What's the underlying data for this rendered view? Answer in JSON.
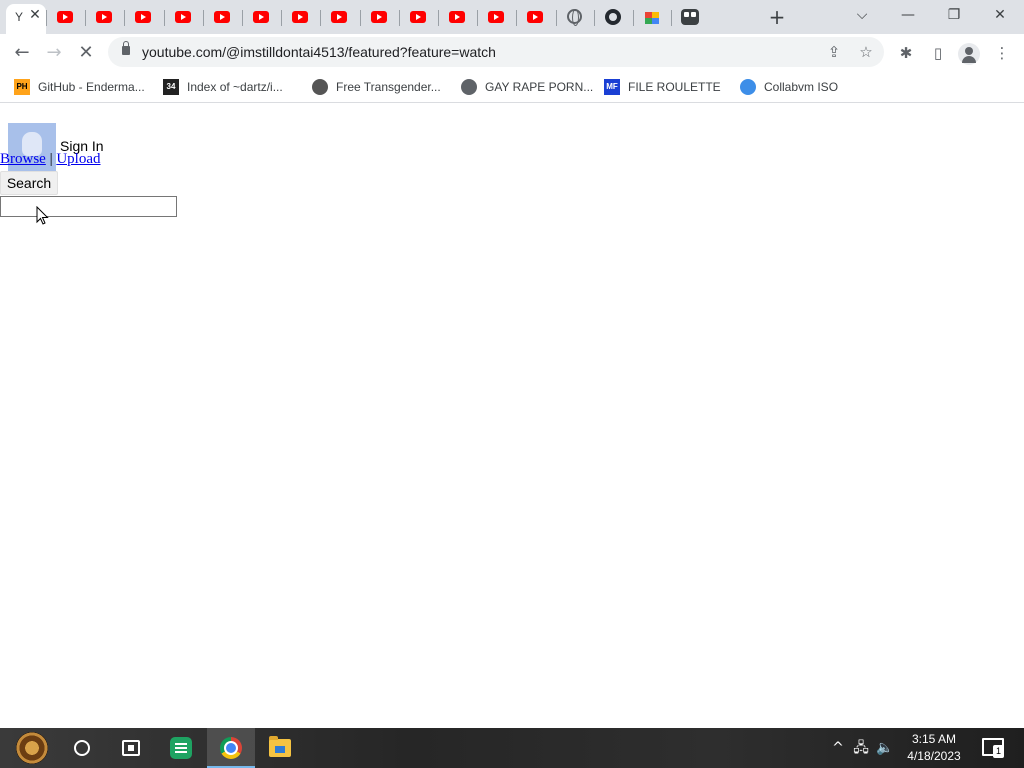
{
  "browser": {
    "active_tab": {
      "title": "Y",
      "close_glyph": "✕",
      "icon": "youtube-icon"
    },
    "other_tab_icons": [
      "youtube-icon",
      "youtube-icon",
      "youtube-icon",
      "youtube-icon",
      "youtube-icon",
      "youtube-icon",
      "youtube-icon",
      "youtube-icon",
      "youtube-icon",
      "youtube-icon",
      "youtube-icon",
      "youtube-icon",
      "youtube-icon",
      "globe-icon",
      "github-icon",
      "color-blocks-icon",
      "tiles-icon"
    ],
    "new_tab_glyph": "+",
    "window_controls": {
      "tab_search": "⌵",
      "minimize": "—",
      "restore": "❐",
      "close": "✕"
    },
    "toolbar": {
      "back_glyph": "←",
      "forward_glyph": "→",
      "reload_glyph": "✕",
      "url": "youtube.com/@imstilldontai4513/featured?feature=watch",
      "share_glyph": "⇪",
      "star_glyph": "☆",
      "extensions_glyph": "✱",
      "sidepanel_glyph": "▯",
      "menu_glyph": "⋮"
    },
    "bookmarks": [
      {
        "label": "GitHub - Enderma...",
        "icon": "ph-icon",
        "icon_text": "PH",
        "color": "#ffa31a"
      },
      {
        "label": "Index of ~dartz/i...",
        "icon": "pixel-icon",
        "icon_text": "34",
        "color": "#222222"
      },
      {
        "label": "Free Transgender...",
        "icon": "shield-icon",
        "icon_text": "",
        "color": "#555555"
      },
      {
        "label": "GAY RAPE PORN...",
        "icon": "globe-icon",
        "icon_text": "",
        "color": "#5f6368"
      },
      {
        "label": "FILE ROULETTE",
        "icon": "mft-icon",
        "icon_text": "MF",
        "color": "#1a3fd4"
      },
      {
        "label": "Collabvm ISO",
        "icon": "collab-icon",
        "icon_text": "",
        "color": "#3d8ee8"
      }
    ]
  },
  "page": {
    "avatar_icon": "avatar-placeholder-icon",
    "sign_in": "Sign In",
    "browse": "Browse",
    "separator": "|",
    "upload": "Upload",
    "search_button": "Search",
    "search_value": ""
  },
  "taskbar": {
    "apps": [
      "start-icon",
      "cortana-icon",
      "task-view-icon",
      "sheets-icon",
      "chrome-icon",
      "file-explorer-icon"
    ],
    "tray": {
      "chevron": "^",
      "network": "🖧",
      "volume": "🔈"
    },
    "time": "3:15 AM",
    "date": "4/18/2023",
    "notification_count": "1"
  },
  "colors": {
    "tab_strip": "#dee1e6",
    "link": "#0000ee",
    "youtube_red": "#ff0000",
    "taskbar": "#262626"
  }
}
